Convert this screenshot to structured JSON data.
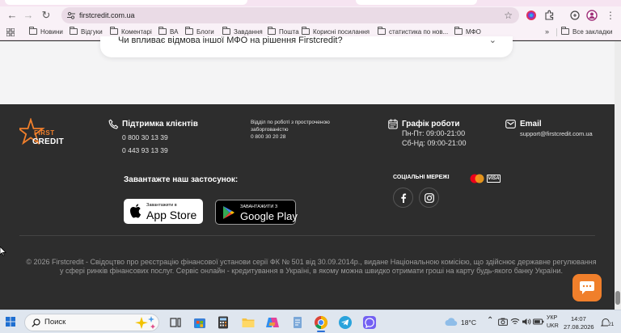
{
  "browser": {
    "url": "firstcredit.com.ua",
    "bookmarks": [
      "Новини",
      "Відгуки",
      "Коментарі",
      "ВА",
      "Блоги",
      "Завдання",
      "Пошта",
      "Корисні посилання",
      "статистика по нов...",
      "МФО"
    ],
    "all_bookmarks": "Все закладки"
  },
  "page": {
    "faq_question": "Чи впливає відмова іншої МФО на рішення Firstcredit?",
    "logo": {
      "first": "FIRST",
      "credit": "CREDIT"
    },
    "support": {
      "title": "Підтримка клієнтів",
      "phone1": "0 800 30 13 39",
      "phone2": "0 443 93 13 39"
    },
    "overdue": {
      "title_line1": "Відділ по роботі з простроченою",
      "title_line2": "заборгованістю",
      "phone": "0 800 30 20 28"
    },
    "schedule": {
      "title": "Графік роботи",
      "weekdays": "Пн-Пт: 09:00-21:00",
      "weekend": "Сб-Нд: 09:00-21:00"
    },
    "email": {
      "title": "Email",
      "address": "support@firstcredit.com.ua"
    },
    "payment_logos": {
      "visa": "VISA"
    },
    "download_title": "Завантажте наш застосунок:",
    "appstore": {
      "small": "Завантажити в",
      "big": "App Store"
    },
    "googleplay": {
      "small": "ЗАВАНТАЖИТИ З",
      "big": "Google Play"
    },
    "social_title": "СОЦІАЛЬНІ МЕРЕЖІ",
    "copyright": "© 2026 Firstcredit - Свідоцтво про реєстрацію фінансової установи серії ФК № 501 від 30.09.2014р., видане Національною комісією, що здійснює державне регулювання у сфері ринків фінансових послуг. Сервіс онлайн - кредитування в Україні, в якому можна швидко отримати гроші на карту будь-якого банку України."
  },
  "taskbar": {
    "search_placeholder": "Поиск",
    "weather": "18°C",
    "lang_top": "УКР",
    "lang_bottom": "UKR",
    "time": "14:07",
    "date": "27.08.2026",
    "notifications": "21"
  },
  "colors": {
    "brand_orange": "#f07f2b",
    "footer_bg": "#2d2d2d"
  }
}
